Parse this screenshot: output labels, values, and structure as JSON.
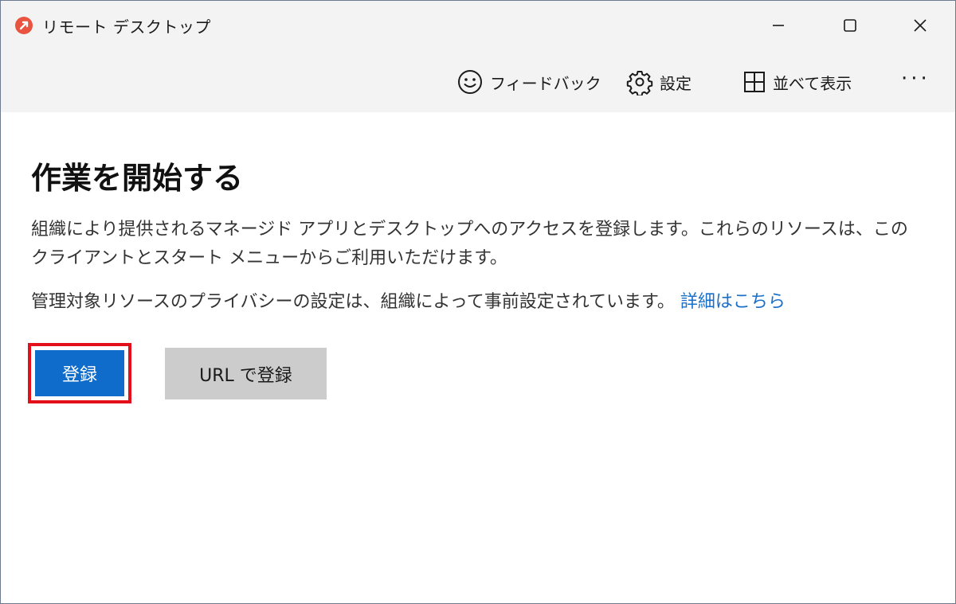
{
  "window": {
    "title": "リモート デスクトップ"
  },
  "toolbar": {
    "feedback_label": "フィードバック",
    "settings_label": "設定",
    "tile_label": "並べて表示",
    "more_label": "···"
  },
  "main": {
    "heading": "作業を開始する",
    "description": "組織により提供されるマネージド アプリとデスクトップへのアクセスを登録します。これらのリソースは、このクライアントとスタート メニューからご利用いただけます。",
    "privacy_text": "管理対象リソースのプライバシーの設定は、組織によって事前設定されています。",
    "privacy_link": "詳細はこちら",
    "register_button": "登録",
    "register_url_button": "URL で登録"
  },
  "colors": {
    "accent": "#0f6ccb",
    "link": "#1a6fc9",
    "highlight_border": "#e3101c",
    "secondary_button": "#cccccc",
    "titlebar": "#f3f3f3"
  }
}
